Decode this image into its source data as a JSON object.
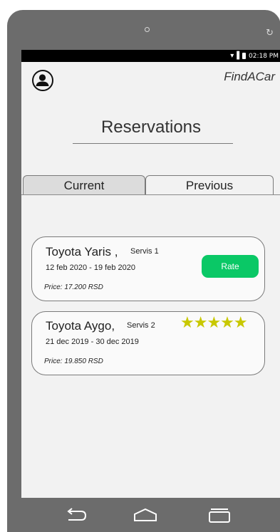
{
  "status_bar": {
    "signal_icon": "wifi-signal-icon",
    "battery_icon": "battery-icon",
    "time": "02:18 PM"
  },
  "header": {
    "app_name": "FindACar",
    "avatar_icon": "user-avatar-icon"
  },
  "page": {
    "title": "Reservations"
  },
  "tabs": [
    {
      "label": "Current",
      "active": true
    },
    {
      "label": "Previous",
      "active": false
    }
  ],
  "reservations": [
    {
      "car": "Toyota Yaris ,",
      "service": "Servis 1",
      "dates": "12 feb 2020 - 19 feb 2020",
      "price": "Price: 17.200 RSD",
      "action_label": "Rate"
    },
    {
      "car": "Toyota Aygo,",
      "service": "Servis 2",
      "dates": "21 dec 2019 - 30 dec 2019",
      "price": "Price: 19.850 RSD",
      "rating": 5,
      "rating_display": "★★★★★"
    }
  ],
  "nav": {
    "back_icon": "back-arrow-icon",
    "home_icon": "home-icon",
    "recent_icon": "recent-apps-icon"
  },
  "colors": {
    "rate_button": "#0ac866",
    "stars": "#c8c800",
    "phone_frame": "#6c6c6c",
    "screen_bg": "#f2f2f2"
  }
}
